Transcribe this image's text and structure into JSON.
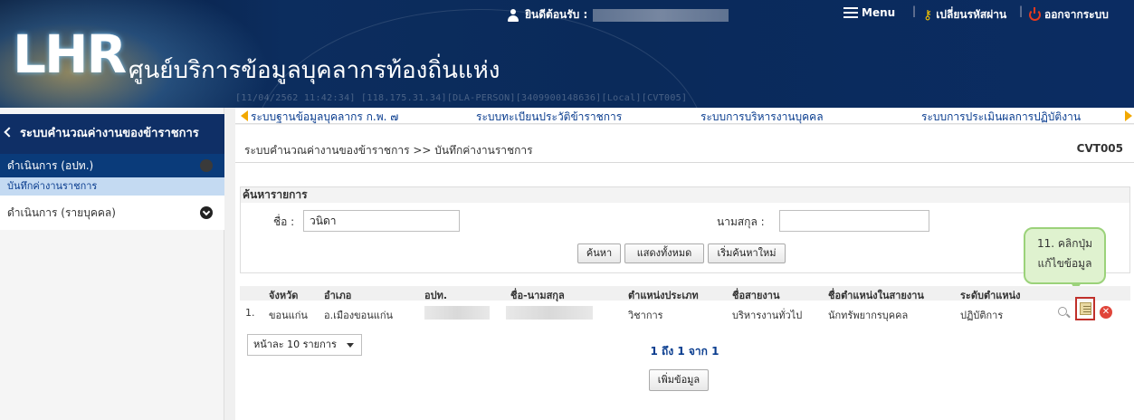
{
  "header": {
    "org_title": "ศูนย์บริการข้อมูลบุคลากรท้องถิ่นแห่ง",
    "logo_text": "LHR",
    "faint_info": "[11/04/2562 11:42:34] [118.175.31.34][DLA-PERSON][3409900148636][Local][CVT005]",
    "welcome_label": "ยินดีต้อนรับ :",
    "menu_label": "Menu",
    "change_password_label": "เปลี่ยนรหัสผ่าน",
    "logout_label": "ออกจากระบบ"
  },
  "navstrip": {
    "items": [
      "ระบบฐานข้อมูลบุคลากร ก.พ. ๗",
      "ระบบทะเบียนประวัติข้าราชการ",
      "ระบบการบริหารงานบุคคล",
      "ระบบการประเมินผลการปฏิบัติงาน"
    ]
  },
  "sidebar": {
    "title": "ระบบคำนวณค่างานของข้าราชการ",
    "item1": "ดำเนินการ (อปท.)",
    "sub1": "บันทึกค่างานราชการ",
    "item2": "ดำเนินการ (รายบุคคล)"
  },
  "main": {
    "breadcrumb": "ระบบคำนวณค่างานของข้าราชการ >> บันทึกค่างานราชการ",
    "screen_code": "CVT005",
    "search": {
      "heading": "ค้นหารายการ",
      "name_label": "ชื่อ :",
      "name_value": "วนิดา",
      "surname_label": "นามสกุล :",
      "surname_value": "",
      "btn_search": "ค้นหา",
      "btn_show_all": "แสดงทั้งหมด",
      "btn_reset": "เริ่มค้นหาใหม่"
    },
    "tooltip": {
      "line1": "11. คลิกปุ่ม",
      "line2": "แก้ไขข้อมูล"
    },
    "table": {
      "headers": [
        "จังหวัด",
        "อำเภอ",
        "อปท.",
        "ชื่อ-นามสกุล",
        "ตำแหน่งประเภท",
        "ชื่อสายงาน",
        "ชื่อตำแหน่งในสายงาน",
        "ระดับตำแหน่ง"
      ],
      "rows": [
        {
          "no": "1.",
          "province": "ขอนแก่น",
          "district": "อ.เมืองขอนแก่น",
          "org": "",
          "name": "",
          "type": "วิชาการ",
          "line": "บริหารงานทั่วไป",
          "position": "นักทรัพยากรบุคคล",
          "level": "ปฏิบัติการ"
        }
      ]
    },
    "pager_text": "1 ถึง 1 จาก 1",
    "page_size": "หน้าละ 10 รายการ",
    "btn_add": "เพิ่มข้อมูล"
  }
}
